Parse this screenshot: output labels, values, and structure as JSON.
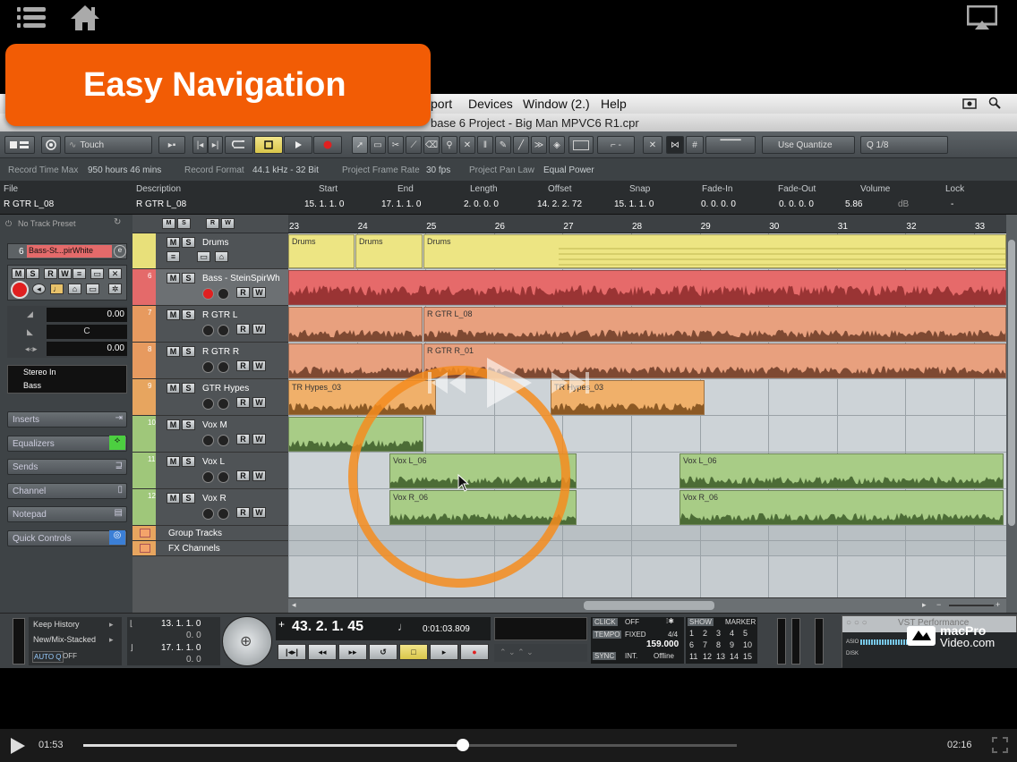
{
  "overlay": {
    "banner_label": "Easy Navigation",
    "menu_icon": "hamburger-menu-icon",
    "home_icon": "home-icon",
    "airplay_icon": "airplay-icon"
  },
  "menubar": {
    "items": [
      "port",
      "Devices",
      "Window (2.)",
      "Help"
    ]
  },
  "titlebar": {
    "title": "base 6 Project - Big Man MPVC6 R1.cpr"
  },
  "toolbar": {
    "automation_mode": "Touch",
    "quantize_type": "Use Quantize",
    "quantize_value": "Q  1/8"
  },
  "statusline": {
    "items": [
      {
        "label": "Record Time Max",
        "value": "950 hours 46 mins"
      },
      {
        "label": "Record Format",
        "value": "44.1 kHz - 32 Bit"
      },
      {
        "label": "Project Frame Rate",
        "value": "30 fps"
      },
      {
        "label": "Project Pan Law",
        "value": "Equal Power"
      }
    ]
  },
  "infoline": {
    "headers": [
      "File",
      "Description",
      "Start",
      "End",
      "Length",
      "Offset",
      "Snap",
      "Fade-In",
      "Fade-Out",
      "Volume",
      "Lock"
    ],
    "values": [
      "R GTR L_08",
      "R GTR L_08",
      "15. 1. 1.   0",
      "17. 1. 1.   0",
      "2. 0. 0.   0",
      "14. 2. 2. 72",
      "15. 1. 1.   0",
      "0. 0. 0.   0",
      "0. 0. 0.   0",
      "5.86",
      "-"
    ],
    "volume_unit": "dB"
  },
  "inspector": {
    "preset": "No Track Preset",
    "track_number": "6",
    "track_name": "Bass-St...pirWhite",
    "volume_value": "0.00",
    "pan_value": "C",
    "delay_value": "0.00",
    "input": "Stereo In",
    "output": "Bass",
    "sections": [
      "Inserts",
      "Equalizers",
      "Sends",
      "Channel",
      "Notepad",
      "Quick Controls"
    ]
  },
  "tracks": [
    {
      "num": "",
      "name": "Drums",
      "color": "#e8e07a"
    },
    {
      "num": "6",
      "name": "Bass - SteinSpirWh",
      "color": "#e46a6a"
    },
    {
      "num": "7",
      "name": "R GTR L",
      "color": "#e79a5f"
    },
    {
      "num": "8",
      "name": "R GTR R",
      "color": "#e79a5f"
    },
    {
      "num": "9",
      "name": "GTR Hypes",
      "color": "#e7a55f"
    },
    {
      "num": "10",
      "name": "Vox M",
      "color": "#9fc77a"
    },
    {
      "num": "11",
      "name": "Vox L",
      "color": "#9fc77a"
    },
    {
      "num": "12",
      "name": "Vox R",
      "color": "#9fc77a"
    },
    {
      "num": "",
      "name": "Group Tracks",
      "color": "#e7a55f"
    },
    {
      "num": "",
      "name": "FX Channels",
      "color": "#e7a55f"
    }
  ],
  "ruler": [
    "23",
    "24",
    "25",
    "26",
    "27",
    "28",
    "29",
    "30",
    "31",
    "32",
    "33"
  ],
  "parts": [
    {
      "label": "Drums"
    },
    {
      "label": "Drums"
    },
    {
      "label": "Drums"
    },
    {
      "label": "R GTR L_08"
    },
    {
      "label": "R GTR R_01"
    },
    {
      "label": "TR Hypes_03"
    },
    {
      "label": "TR Hypes_03"
    },
    {
      "label": "Vox L_06"
    },
    {
      "label": "Vox L_06"
    },
    {
      "label": "Vox R_06"
    },
    {
      "label": "Vox R_06"
    }
  ],
  "transport": {
    "keep_history": "Keep History",
    "record_mode": "New/Mix-Stacked",
    "auto_q": "AUTO Q",
    "auto_q_state": "OFF",
    "left_locator": "13. 1. 1.   0",
    "left_locator_b": "0.   0",
    "right_locator": "17. 1. 1.   0",
    "right_locator_b": "0.   0",
    "position_bars": "43. 2. 1. 45",
    "position_time": "0:01:03.809",
    "click_label": "CLICK",
    "click_state": "OFF",
    "tempo_label": "TEMPO",
    "tempo_mode": "FIXED",
    "signature": "4/4",
    "tempo_value": "159.000",
    "sync_label": "SYNC",
    "sync_mode": "INT.",
    "sync_state": "Offline",
    "show_label": "SHOW",
    "marker_label": "MARKER",
    "markers": [
      "1",
      "2",
      "3",
      "4",
      "5",
      "6",
      "7",
      "8",
      "9",
      "10",
      "11",
      "12",
      "13",
      "14",
      "15"
    ],
    "vst_title": "VST Performance",
    "asio_label": "ASIO",
    "disk_label": "DISK"
  },
  "watermark": {
    "brand_line1": "macPro",
    "brand_line2": "Video.com"
  },
  "player": {
    "elapsed": "01:53",
    "remaining": "02:16",
    "progress_fraction": 0.581
  }
}
